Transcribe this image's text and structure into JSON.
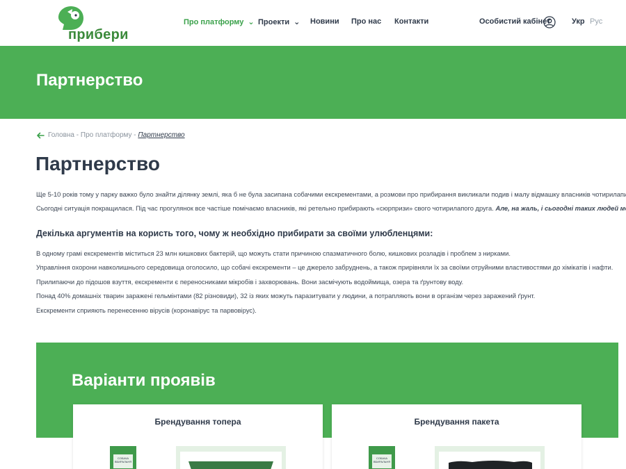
{
  "header": {
    "logo_text": "прибери",
    "nav": [
      {
        "label": "Про платформу",
        "active": true,
        "has_dropdown": true
      },
      {
        "label": "Проекти",
        "active": false,
        "has_dropdown": true
      },
      {
        "label": "Новини",
        "active": false,
        "has_dropdown": false
      },
      {
        "label": "Про нас",
        "active": false,
        "has_dropdown": false
      },
      {
        "label": "Контакти",
        "active": false,
        "has_dropdown": false
      }
    ],
    "cabinet_label": "Особистий кабінет",
    "lang_active": "Укр",
    "lang_other": "Рус"
  },
  "banner": {
    "title": "Партнерство"
  },
  "breadcrumb": {
    "home": "Головна",
    "sep1": " - ",
    "parent": "Про платформу",
    "sep2": " - ",
    "current": "Партнерство"
  },
  "page_title": "Партнерство",
  "intro": {
    "p1": "Ще 5-10 років тому у парку важко було знайти ділянку землі, яка б не була засипана собачими екскрементами, а розмови про прибирання викликали подив і малу відмашку власників чотирилапих.",
    "p2": "Сьогодні ситуація покращилася. Під час прогулянок все частіше помічаємо власників,  які ретельно прибирають «сюрпризи» свого чотирилапого друга.",
    "p2_emphasis": "Але, на жаль, і сьогодні таких людей меншість."
  },
  "arguments": {
    "heading": "Декілька аргументів на користь того, чому ж необхідно прибирати за своїми улюбленцями:",
    "items": [
      "В одному грамі екскрементів міститься 23 млн кишкових бактерій, що можуть стати причиною спазматичного болю, кишкових розладів і проблем з нирками.",
      "Управління охорони навколишнього середовища оголосило, що собачі екскременти – це джерело забруднень, а також прирівняли їх за своїми отруйними властивостями до хімікатів і нафти.",
      "Прилипаючи до підошов взуття, екскременти є переносниками мікробів і захворювань. Вони засмічують водоймища, озера та ґрунтову воду.",
      "Понад 40% домашніх тварин заражені гельмінтами (82 різновиди), 32 із яких можуть паразитувати у людини, а потрапляють вони в організм через заражений ґрунт.",
      "Екскременти сприяють перенесенню вірусів (коронавірус та парвовірус)."
    ]
  },
  "variants": {
    "title": "Варіанти проявів",
    "cards": [
      {
        "title": "Брендування топера",
        "box_label": "СОБАЧА ВБИРАЛЬНЯ"
      },
      {
        "title": "Брендування пакета",
        "box_label": "СОБАЧА ВБИРАЛЬНЯ"
      }
    ]
  },
  "colors": {
    "brand_green": "#4caf55",
    "text_dark": "#2f3a4a",
    "link_muted": "#8a939d"
  }
}
